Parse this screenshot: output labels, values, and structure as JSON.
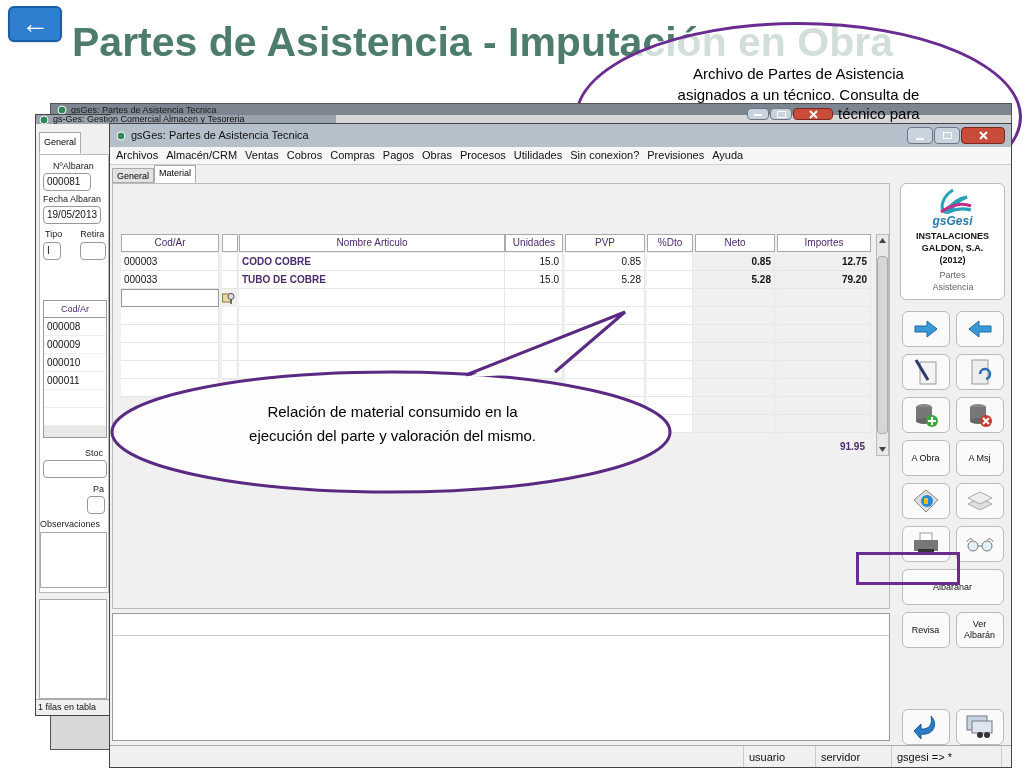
{
  "slide": {
    "back_button": "←",
    "title": "Partes de Asistencia - Imputación en Obra"
  },
  "callouts": [
    {
      "lines": [
        "Archivo de Partes de Asistencia",
        "asignados a un técnico. Consulta de",
        "técnico para"
      ]
    },
    {
      "lines": [
        "Relación de material consumido en la",
        "ejecución del parte y valoración del mismo."
      ]
    }
  ],
  "back_window": {
    "title": "gsGes: Partes de Asistencia Tecnica"
  },
  "middle_window": {
    "title": "gs-Ges: Gestion Comercial Almacen y Tesoreria",
    "tabs": [
      {
        "label": "General",
        "selected": true
      }
    ],
    "fields": [
      {
        "label": "NºAlbaran",
        "value": "000081"
      },
      {
        "label": "Fecha Albaran",
        "value": "19/05/2013"
      },
      {
        "label": "Tipo",
        "value": "I"
      },
      {
        "label": "Retira"
      }
    ],
    "table": {
      "columns": [
        "Cod/Ar"
      ],
      "rows": [
        "000008",
        "000009",
        "000010",
        "000011"
      ]
    },
    "labels": [
      "Stoc",
      "Pa",
      "Observaciones"
    ],
    "status_bar": "1 filas en tabla"
  },
  "main_window": {
    "title": "gsGes: Partes de Asistencia Tecnica",
    "menu": [
      "Archivos",
      "Almacén/CRM",
      "Ventas",
      "Cobros",
      "Compras",
      "Pagos",
      "Obras",
      "Procesos",
      "Utilidades",
      "Sin conexion?",
      "Previsiones",
      "Ayuda"
    ],
    "tabs": [
      {
        "label": "General",
        "selected": false
      },
      {
        "label": "Material",
        "selected": true
      }
    ],
    "table": {
      "columns": [
        "Cod/Ar",
        "",
        "Nombre Articulo",
        "Unidades",
        "PVP",
        "%Dto",
        "Neto",
        "Importes"
      ],
      "rows": [
        {
          "cod": "000003",
          "name": "CODO COBRE",
          "units": "15.0",
          "pvp": "0.85",
          "neto": "0.85",
          "importe": "12.75"
        },
        {
          "cod": "000033",
          "name": "TUBO DE COBRE",
          "units": "15.0",
          "pvp": "5.28",
          "neto": "5.28",
          "importe": "79.20"
        }
      ],
      "total": "91.95"
    },
    "side_panel": {
      "logo": "gsGesi",
      "company": [
        "INSTALACIONES",
        "GALDON, S.A.",
        "(2012)"
      ],
      "module": "Partes Asistencia",
      "text_buttons": [
        "A Obra",
        "A Msj",
        "Albaranar",
        "Revisa",
        "Ver Albarán"
      ]
    },
    "status_bar": [
      "usuario",
      "servidor",
      "gsgesi => *"
    ]
  }
}
